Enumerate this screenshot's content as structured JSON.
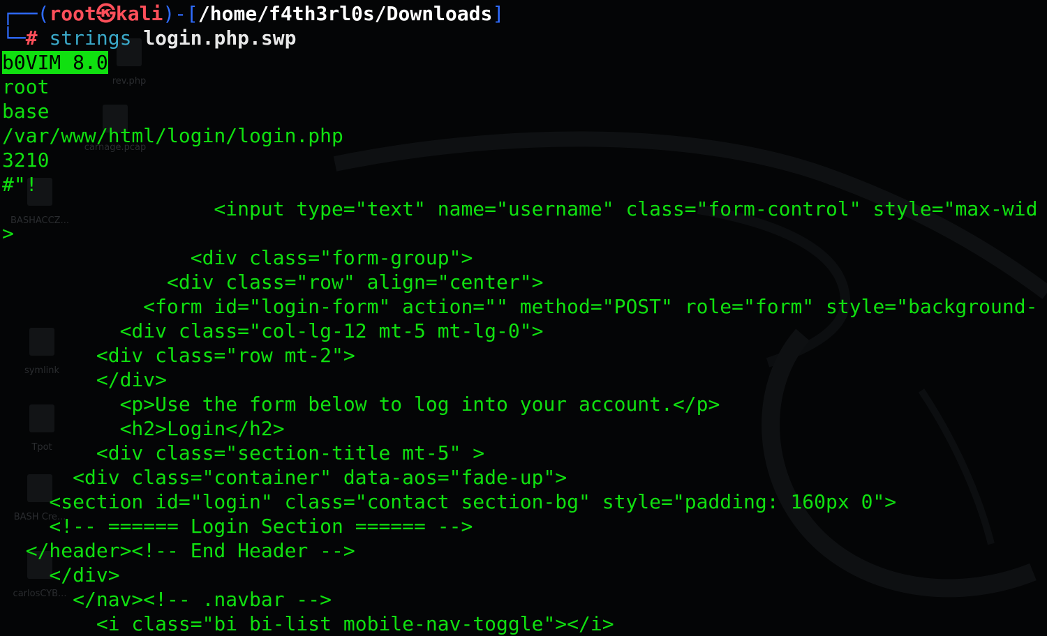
{
  "prompt": {
    "corner_top": "┌──(",
    "user": "root",
    "skull": "㉿",
    "host": "kali",
    "sep": ")-[",
    "cwd": "/home/f4th3rl0s/Downloads",
    "close": "]",
    "corner_bottom": "└─",
    "hash": "#",
    "command": "strings",
    "argument": "login.php.swp"
  },
  "output": {
    "highlighted_first": "b0VIM 8.0",
    "lines": [
      "root",
      "base",
      "/var/www/html/login/login.php",
      "3210",
      "#\"!",
      "                  <input type=\"text\" name=\"username\" class=\"form-control\" style=\"max-wid",
      ">",
      "                <div class=\"form-group\">",
      "              <div class=\"row\" align=\"center\">",
      "            <form id=\"login-form\" action=\"\" method=\"POST\" role=\"form\" style=\"background-",
      "          <div class=\"col-lg-12 mt-5 mt-lg-0\">",
      "        <div class=\"row mt-2\">",
      "        </div>",
      "          <p>Use the form below to log into your account.</p>",
      "          <h2>Login</h2>",
      "        <div class=\"section-title mt-5\" >",
      "      <div class=\"container\" data-aos=\"fade-up\">",
      "    <section id=\"login\" class=\"contact section-bg\" style=\"padding: 160px 0\">",
      "    <!-- ====== Login Section ====== -->",
      "  </header><!-- End Header -->",
      "    </div>",
      "      </nav><!-- .navbar -->",
      "        <i class=\"bi bi-list mobile-nav-toggle\"></i>"
    ]
  },
  "desktop_icons": [
    "rev.php",
    "carnage.pcap",
    "BASHACCZ...",
    "symlink",
    "Tpot",
    "BASH Cre...",
    "carlosCYB..."
  ],
  "colors": {
    "background": "#040506",
    "output_green": "#10e010",
    "prompt_red": "#ff4f5a",
    "prompt_blue": "#2f6cff",
    "command_cyan": "#3aa8c8"
  }
}
